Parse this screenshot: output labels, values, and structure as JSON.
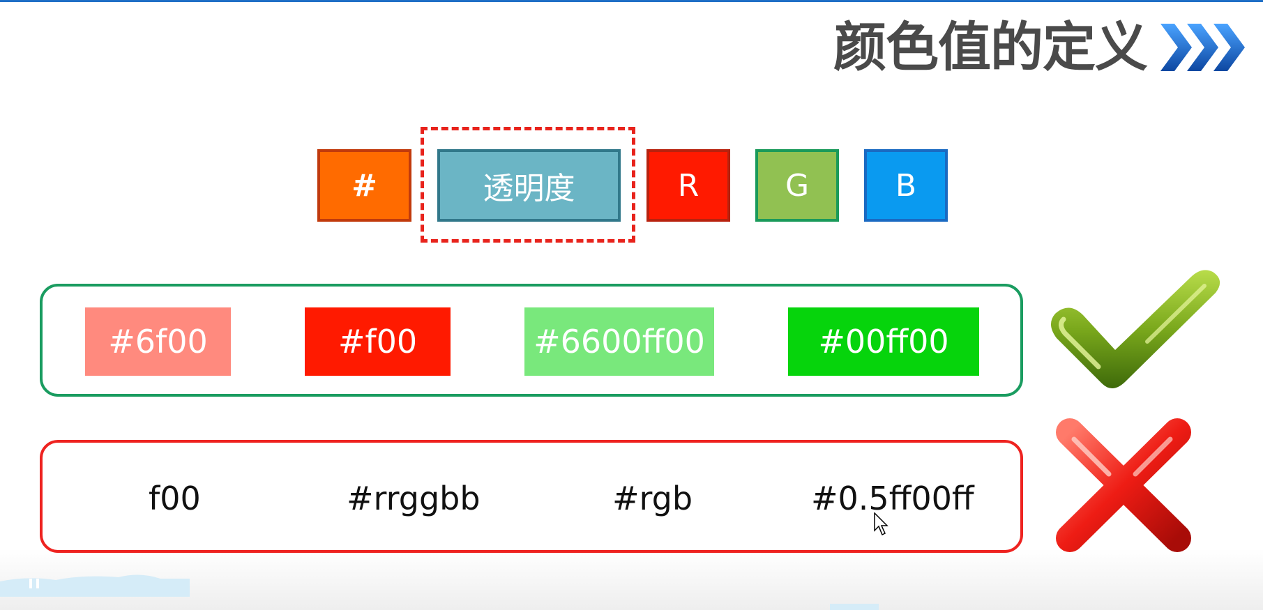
{
  "slide": {
    "title": "颜色值的定义"
  },
  "format": {
    "hash": "#",
    "alpha": "透明度",
    "r": "R",
    "g": "G",
    "b": "B"
  },
  "valid_examples": [
    "#6f00",
    "#f00",
    "#6600ff00",
    "#00ff00"
  ],
  "invalid_examples": [
    "f00",
    "#rrggbb",
    "#rgb",
    "#0.5ff00ff"
  ],
  "colors": {
    "title": "#4a4a4a",
    "chevron": "#1565c0",
    "hash_box": "#ff6b00",
    "alpha_box": "#6bb5c5",
    "r_box": "#ff1a00",
    "g_box": "#91c152",
    "b_box": "#0a9af0",
    "valid_border": "#1a9c60",
    "invalid_border": "#ee2320",
    "swatch_6f00": "#ff8a7e",
    "swatch_f00": "#ff1a00",
    "swatch_6600ff00": "#79e87c",
    "swatch_00ff00": "#06d40c"
  },
  "icons": [
    "chevron-right-icon",
    "check-icon",
    "cross-icon",
    "mouse-cursor-icon"
  ]
}
